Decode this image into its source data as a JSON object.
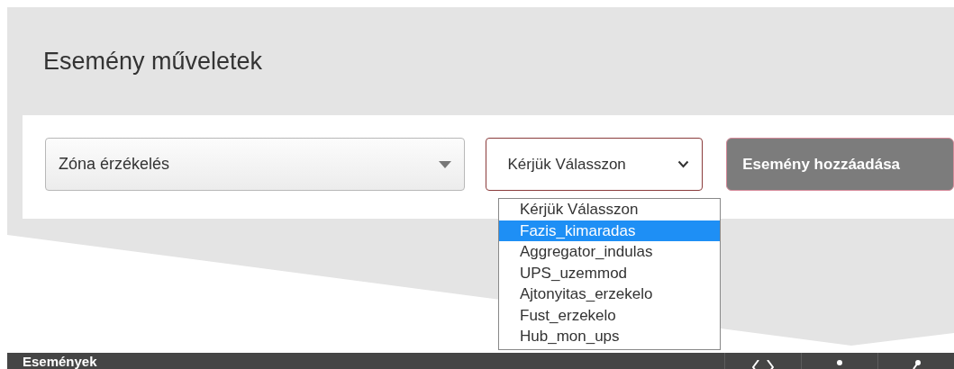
{
  "page_title": "Esemény műveletek",
  "zone_select": {
    "value": "Zóna érzékelés"
  },
  "event_select": {
    "value": "Kérjük Válasszon",
    "expanded": true,
    "options": [
      {
        "label": "Kérjük Válasszon",
        "highlighted": false
      },
      {
        "label": "Fazis_kimaradas",
        "highlighted": true
      },
      {
        "label": "Aggregator_indulas",
        "highlighted": false
      },
      {
        "label": "UPS_uzemmod",
        "highlighted": false
      },
      {
        "label": "Ajtonyitas_erzekelo",
        "highlighted": false
      },
      {
        "label": "Fust_erzekelo",
        "highlighted": false
      },
      {
        "label": "Hub_mon_ups",
        "highlighted": false
      }
    ]
  },
  "add_button": {
    "label": "Esemény hozzáadása"
  },
  "events_bar": {
    "title": "Események"
  }
}
